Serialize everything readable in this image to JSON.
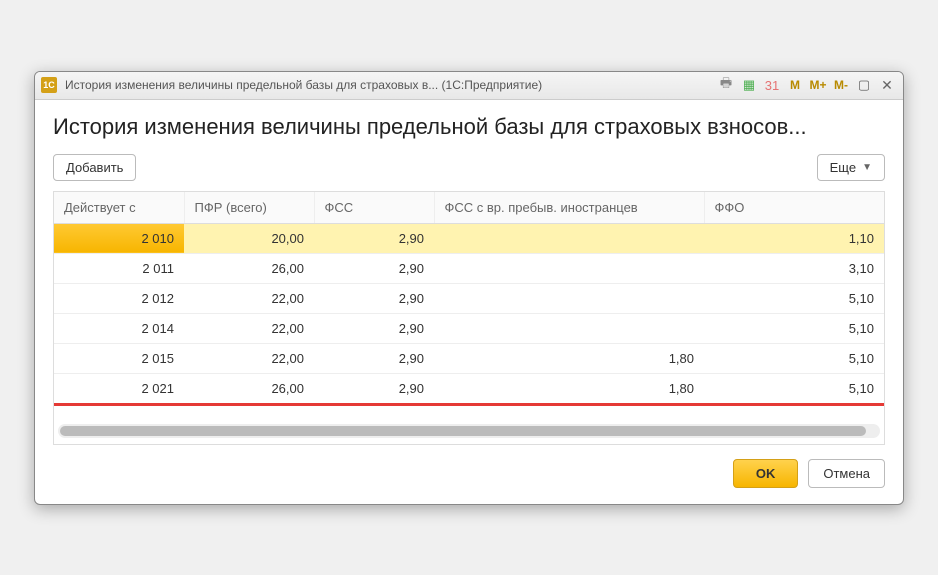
{
  "window": {
    "logo": "1C",
    "title": "История изменения величины предельной базы для страховых в... (1С:Предприятие)",
    "icons": {
      "print": "🖶",
      "calc": "▦",
      "calendar": "31",
      "m": "M",
      "mplus": "M+",
      "mminus": "M-",
      "minimize": "▢",
      "close": "✕"
    }
  },
  "heading": "История изменения величины предельной базы для страховых взносов...",
  "toolbar": {
    "add_label": "Добавить",
    "more_label": "Еще"
  },
  "table": {
    "columns": {
      "date": "Действует с",
      "pfr": "ПФР (всего)",
      "fss": "ФСС",
      "fss_foreign": "ФСС с вр. пребыв. иностранцев",
      "ffo": "ФФО"
    },
    "rows": [
      {
        "date": "2 010",
        "pfr": "20,00",
        "fss": "2,90",
        "fss_foreign": "",
        "ffo": "1,10",
        "selected": true
      },
      {
        "date": "2 011",
        "pfr": "26,00",
        "fss": "2,90",
        "fss_foreign": "",
        "ffo": "3,10",
        "selected": false
      },
      {
        "date": "2 012",
        "pfr": "22,00",
        "fss": "2,90",
        "fss_foreign": "",
        "ffo": "5,10",
        "selected": false
      },
      {
        "date": "2 014",
        "pfr": "22,00",
        "fss": "2,90",
        "fss_foreign": "",
        "ffo": "5,10",
        "selected": false
      },
      {
        "date": "2 015",
        "pfr": "22,00",
        "fss": "2,90",
        "fss_foreign": "1,80",
        "ffo": "5,10",
        "selected": false
      },
      {
        "date": "2 021",
        "pfr": "26,00",
        "fss": "2,90",
        "fss_foreign": "1,80",
        "ffo": "5,10",
        "selected": false
      }
    ]
  },
  "footer": {
    "ok": "OK",
    "cancel": "Отмена"
  }
}
